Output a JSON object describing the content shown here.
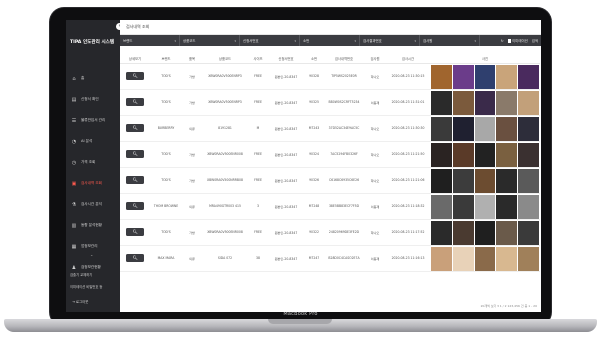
{
  "device": {
    "brand": "MacBook Pro"
  },
  "app": {
    "title": "TIPA 인도관리 시스템",
    "page_title": "검사내역 조회"
  },
  "sidebar": {
    "items": [
      {
        "label": "홈",
        "icon": "home-icon",
        "active": false
      },
      {
        "label": "신청서 확인",
        "icon": "document-icon",
        "active": false
      },
      {
        "label": "물류반입서 관리",
        "icon": "list-icon",
        "active": false
      },
      {
        "label": "AI 분석",
        "icon": "analytics-icon",
        "active": false
      },
      {
        "label": "가격 조회",
        "icon": "clock-icon",
        "active": false
      },
      {
        "label": "검사내역 조회",
        "icon": "clipboard-icon",
        "active": true
      },
      {
        "label": "검사시간 분석",
        "icon": "flask-icon",
        "active": false
      },
      {
        "label": "동향 분석현황",
        "icon": "chart-icon",
        "active": false
      },
      {
        "label": "업정보관리",
        "icon": "building-icon",
        "active": false
      },
      {
        "label": "검정보관현황",
        "icon": "users-icon",
        "active": false
      }
    ],
    "links": [
      "검출기 교체하기",
      "이미테이션 비밀번호 등"
    ],
    "logout": "로그아웃"
  },
  "filters": [
    {
      "label": "브랜드"
    },
    {
      "label": "상품코드"
    },
    {
      "label": "신청서번호"
    },
    {
      "label": "소번"
    },
    {
      "label": "검사결과번호"
    },
    {
      "label": "검사원"
    }
  ],
  "filter_tools": {
    "reset": "↻",
    "check_label": "이미테이션",
    "search": "검색"
  },
  "table": {
    "columns": [
      "상세보기",
      "브랜드",
      "품목",
      "상품코드",
      "사이즈",
      "신청서번호",
      "소번",
      "검사내역번호",
      "검사원",
      "검사시간",
      "사진"
    ],
    "rows": [
      {
        "brand": "TOD'S",
        "item": "가방",
        "code": "XBW0RA0V500ENRP3",
        "size": "FREE",
        "app_no": "원본인-20-8347",
        "sub": "90328",
        "result_no": "TIP5WS2025E0R",
        "inspector": "하나오",
        "time": "2020-08-23 11:30:15",
        "colors": [
          "#a0652e",
          "#6b3c8a",
          "#2f3f6e",
          "#c9a47a",
          "#4a2a5e"
        ]
      },
      {
        "brand": "TOD'S",
        "item": "가방",
        "code": "XBW0RA0V500ENRP3",
        "size": "FREE",
        "app_no": "원본인-20-8347",
        "sub": "90325",
        "result_no": "BB0W0S2CRFT5234",
        "inspector": "이동재",
        "time": "2020-08-23 11:31:01",
        "colors": [
          "#2a2a2a",
          "#7b5a3c",
          "#3a2a4a",
          "#8a7a6a",
          "#c2a07a"
        ]
      },
      {
        "brand": "BURBERRY",
        "item": "의류",
        "code": "8191281",
        "size": "M",
        "app_no": "원본인-20-8347",
        "sub": "M7243",
        "result_no": "37D52AC34E9AC5C",
        "inspector": "하나오",
        "time": "2020-08-23 11:30:30",
        "colors": [
          "#3a3a3a",
          "#1f2030",
          "#a8a8a8",
          "#6a5040",
          "#2d2d3a"
        ]
      },
      {
        "brand": "TOD'S",
        "item": "가방",
        "code": "XBW0RA0V500ENR008",
        "size": "FREE",
        "app_no": "원본인-20-8347",
        "sub": "90324",
        "result_no": "7AC5294FB0326F",
        "inspector": "하나오",
        "time": "2020-08-23 11:21:50",
        "colors": [
          "#2a2322",
          "#5a3a28",
          "#222222",
          "#7a6040",
          "#3a3030"
        ]
      },
      {
        "brand": "TOD'S",
        "item": "가방",
        "code": "XBW0RA0V500NRRB08",
        "size": "FREE",
        "app_no": "원본인-20-8347",
        "sub": "90326",
        "result_no": "C6168C6935C6E26",
        "inspector": "하나오",
        "time": "2020-08-23 11:21:06",
        "colors": [
          "#1f1f1f",
          "#3c3c3c",
          "#6c4c30",
          "#2a2a2a",
          "#5a5a5a"
        ]
      },
      {
        "brand": "THOM BROWNE",
        "item": "의류",
        "code": "MRA490GTR003 415",
        "size": "3",
        "app_no": "원본인-20-8347",
        "sub": "M7248",
        "result_no": "38E5BB83ECF7F5D",
        "inspector": "이동재",
        "time": "2020-08-23 11:18:32",
        "colors": [
          "#6a6a6a",
          "#3a3a3a",
          "#b0b0b0",
          "#2a2a2a",
          "#8a8a8a"
        ]
      },
      {
        "brand": "TOD'S",
        "item": "가방",
        "code": "XBW0RA0V500ENR008",
        "size": "FREE",
        "app_no": "원본인-20-8347",
        "sub": "90322",
        "result_no": "24820969DE3FE2D",
        "inspector": "하나오",
        "time": "2020-08-23 11:17:52",
        "colors": [
          "#2a2a2a",
          "#4a3a30",
          "#1f1f1f",
          "#6a5a4a",
          "#3a3a3a"
        ]
      },
      {
        "brand": "MAX MARA",
        "item": "의류",
        "code": "SIDA 072",
        "size": "38",
        "app_no": "원본인-20-8347",
        "sub": "M7247",
        "result_no": "B28D0C4CASO2E7A",
        "inspector": "이동재",
        "time": "2020-08-23 11:16:13",
        "colors": [
          "#c9a07a",
          "#e8d2b8",
          "#8a6a4a",
          "#d8b890",
          "#a0805a"
        ]
      }
    ]
  },
  "pager": {
    "text": "20개씩 보기  ▾   1 / 2   123,456 건 중 1 - 20"
  }
}
